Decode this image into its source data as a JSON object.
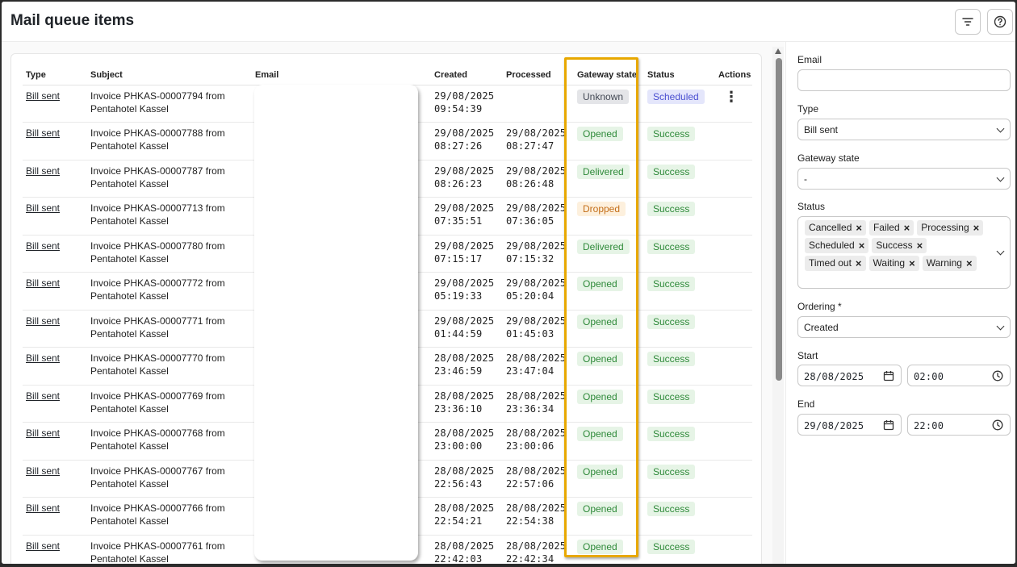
{
  "page": {
    "title": "Mail queue items"
  },
  "header": {
    "filter_icon": "filter-icon",
    "help_icon": "help-icon"
  },
  "table": {
    "columns": [
      "Type",
      "Subject",
      "Email",
      "Created",
      "Processed",
      "Gateway state",
      "Status",
      "Actions"
    ],
    "rows": [
      {
        "type": "Bill sent",
        "subject": "Invoice PHKAS-00007794 from\nPentahotel Kassel",
        "created": "29/08/2025\n09:54:39",
        "processed": "",
        "gateway": "Unknown",
        "status": "Scheduled",
        "actions": "⋮"
      },
      {
        "type": "Bill sent",
        "subject": "Invoice PHKAS-00007788 from\nPentahotel Kassel",
        "created": "29/08/2025\n08:27:26",
        "processed": "29/08/2025\n08:27:47",
        "gateway": "Opened",
        "status": "Success"
      },
      {
        "type": "Bill sent",
        "subject": "Invoice PHKAS-00007787 from\nPentahotel Kassel",
        "created": "29/08/2025\n08:26:23",
        "processed": "29/08/2025\n08:26:48",
        "gateway": "Delivered",
        "status": "Success"
      },
      {
        "type": "Bill sent",
        "subject": "Invoice PHKAS-00007713 from\nPentahotel Kassel",
        "created": "29/08/2025\n07:35:51",
        "processed": "29/08/2025\n07:36:05",
        "gateway": "Dropped",
        "status": "Success"
      },
      {
        "type": "Bill sent",
        "subject": "Invoice PHKAS-00007780 from\nPentahotel Kassel",
        "created": "29/08/2025\n07:15:17",
        "processed": "29/08/2025\n07:15:32",
        "gateway": "Delivered",
        "status": "Success"
      },
      {
        "type": "Bill sent",
        "subject": "Invoice PHKAS-00007772 from\nPentahotel Kassel",
        "created": "29/08/2025\n05:19:33",
        "processed": "29/08/2025\n05:20:04",
        "gateway": "Opened",
        "status": "Success"
      },
      {
        "type": "Bill sent",
        "subject": "Invoice PHKAS-00007771 from\nPentahotel Kassel",
        "created": "29/08/2025\n01:44:59",
        "processed": "29/08/2025\n01:45:03",
        "gateway": "Opened",
        "status": "Success"
      },
      {
        "type": "Bill sent",
        "subject": "Invoice PHKAS-00007770 from\nPentahotel Kassel",
        "created": "28/08/2025\n23:46:59",
        "processed": "28/08/2025\n23:47:04",
        "gateway": "Opened",
        "status": "Success"
      },
      {
        "type": "Bill sent",
        "subject": "Invoice PHKAS-00007769 from\nPentahotel Kassel",
        "created": "28/08/2025\n23:36:10",
        "processed": "28/08/2025\n23:36:34",
        "gateway": "Opened",
        "status": "Success"
      },
      {
        "type": "Bill sent",
        "subject": "Invoice PHKAS-00007768 from\nPentahotel Kassel",
        "created": "28/08/2025\n23:00:00",
        "processed": "28/08/2025\n23:00:06",
        "gateway": "Opened",
        "status": "Success"
      },
      {
        "type": "Bill sent",
        "subject": "Invoice PHKAS-00007767 from\nPentahotel Kassel",
        "created": "28/08/2025\n22:56:43",
        "processed": "28/08/2025\n22:57:06",
        "gateway": "Opened",
        "status": "Success"
      },
      {
        "type": "Bill sent",
        "subject": "Invoice PHKAS-00007766 from\nPentahotel Kassel",
        "created": "28/08/2025\n22:54:21",
        "processed": "28/08/2025\n22:54:38",
        "gateway": "Opened",
        "status": "Success"
      },
      {
        "type": "Bill sent",
        "subject": "Invoice PHKAS-00007761 from\nPentahotel Kassel",
        "created": "28/08/2025\n22:42:03",
        "processed": "28/08/2025\n22:42:34",
        "gateway": "Opened",
        "status": "Success"
      }
    ]
  },
  "badge_colors": {
    "Unknown": {
      "bg": "#e4e5e8",
      "fg": "#444a55"
    },
    "Scheduled": {
      "bg": "#e4e6fb",
      "fg": "#4a4fd0"
    },
    "Opened": {
      "bg": "#e6f4e6",
      "fg": "#2f8a3a"
    },
    "Delivered": {
      "bg": "#e6f4e6",
      "fg": "#2f8a3a"
    },
    "Success": {
      "bg": "#e6f4e6",
      "fg": "#2f8a3a"
    },
    "Dropped": {
      "bg": "#fdf0dd",
      "fg": "#c46f1a"
    }
  },
  "highlight_color": "#e8a800",
  "filters": {
    "email": {
      "label": "Email",
      "value": ""
    },
    "type": {
      "label": "Type",
      "value": "Bill sent"
    },
    "gateway_state": {
      "label": "Gateway state",
      "value": "-"
    },
    "status": {
      "label": "Status",
      "chips": [
        "Cancelled",
        "Failed",
        "Processing",
        "Scheduled",
        "Success",
        "Timed out",
        "Waiting",
        "Warning"
      ]
    },
    "ordering": {
      "label": "Ordering *",
      "value": "Created"
    },
    "start": {
      "label": "Start",
      "date": "28/08/2025",
      "time": "02:00"
    },
    "end": {
      "label": "End",
      "date": "29/08/2025",
      "time": "22:00"
    }
  }
}
